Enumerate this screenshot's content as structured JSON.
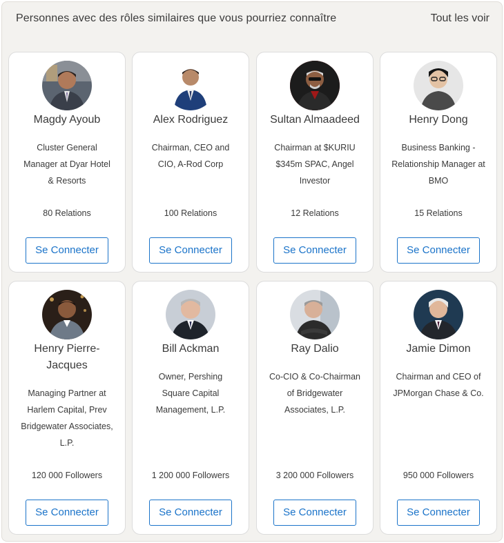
{
  "header": {
    "title": "Personnes avec des rôles similaires que vous pourriez connaître",
    "see_all": "Tout les voir"
  },
  "connect_label": "Se Connecter",
  "accent_color": "#1a73c9",
  "people": [
    {
      "name": "Magdy Ayoub",
      "role": "Cluster General Manager at Dyar Hotel & Resorts",
      "count": "80 Relations",
      "avatar": "avatar-photo"
    },
    {
      "name": "Alex Rodriguez",
      "role": "Chairman, CEO and CIO, A-Rod Corp",
      "count": "100 Relations",
      "avatar": "avatar-photo"
    },
    {
      "name": "Sultan Almaadeed",
      "role": "Chairman at $KURIU $345m SPAC, Angel Investor",
      "count": "12 Relations",
      "avatar": "avatar-photo"
    },
    {
      "name": "Henry Dong",
      "role": "Business Banking - Relationship Manager at BMO",
      "count": "15 Relations",
      "avatar": "avatar-photo"
    },
    {
      "name": "Henry Pierre-Jacques",
      "role": "Managing Partner at Harlem Capital, Prev Bridgewater Associates, L.P.",
      "count": "120 000 Followers",
      "avatar": "avatar-photo"
    },
    {
      "name": "Bill Ackman",
      "role": "Owner, Pershing Square Capital Management, L.P.",
      "count": "1 200 000 Followers",
      "avatar": "avatar-photo"
    },
    {
      "name": "Ray Dalio",
      "role": "Co-CIO & Co-Chairman of Bridgewater Associates, L.P.",
      "count": "3 200 000 Followers",
      "avatar": "avatar-photo"
    },
    {
      "name": "Jamie Dimon",
      "role": "Chairman and CEO of JPMorgan Chase & Co.",
      "count": "950 000 Followers",
      "avatar": "avatar-photo"
    }
  ]
}
